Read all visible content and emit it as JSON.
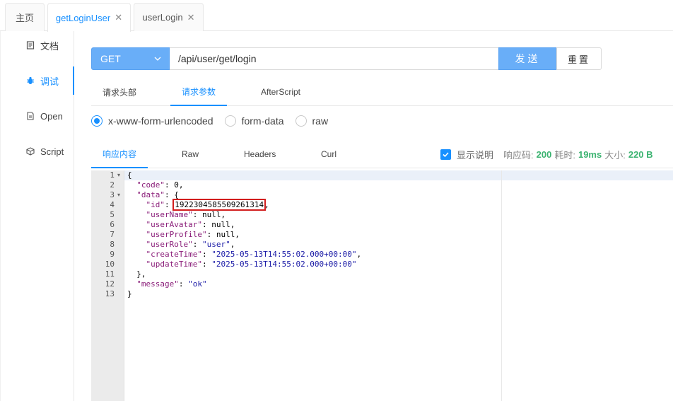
{
  "top_tabs": [
    {
      "label": "主页",
      "closable": false
    },
    {
      "label": "getLoginUser",
      "closable": true,
      "active": true
    },
    {
      "label": "userLogin",
      "closable": true
    }
  ],
  "close_glyph": "✕",
  "sidebar": [
    {
      "label": "文档",
      "icon": "document-icon"
    },
    {
      "label": "调试",
      "icon": "bug-icon",
      "active": true
    },
    {
      "label": "Open",
      "icon": "file-icon"
    },
    {
      "label": "Script",
      "icon": "cube-icon"
    }
  ],
  "request": {
    "method": "GET",
    "url": "/api/user/get/login",
    "send_label": "发送",
    "reset_label": "重置"
  },
  "req_tabs": [
    "请求头部",
    "请求参数",
    "AfterScript"
  ],
  "body_types": [
    "x-www-form-urlencoded",
    "form-data",
    "raw"
  ],
  "resp_tabs": [
    "响应内容",
    "Raw",
    "Headers",
    "Curl"
  ],
  "resp_meta": {
    "show_desc_label": "显示说明",
    "status_label": "响应码:",
    "status": "200",
    "time_label": "耗时:",
    "time": "19ms",
    "size_label": "大小:",
    "size": "220 B"
  },
  "code_lines": [
    {
      "n": "1",
      "fold": true
    },
    {
      "n": "2"
    },
    {
      "n": "3",
      "fold": true
    },
    {
      "n": "4"
    },
    {
      "n": "5"
    },
    {
      "n": "6"
    },
    {
      "n": "7"
    },
    {
      "n": "8"
    },
    {
      "n": "9"
    },
    {
      "n": "10"
    },
    {
      "n": "11"
    },
    {
      "n": "12"
    },
    {
      "n": "13"
    }
  ],
  "json": {
    "open": "{",
    "close": "}",
    "code_key": "\"code\"",
    "code_val": "0",
    "data_key": "\"data\"",
    "id_key": "\"id\"",
    "id_val": "1922304585509261314",
    "userName_key": "\"userName\"",
    "userAvatar_key": "\"userAvatar\"",
    "userProfile_key": "\"userProfile\"",
    "null_val": "null",
    "userRole_key": "\"userRole\"",
    "userRole_val": "\"user\"",
    "createTime_key": "\"createTime\"",
    "createTime_val": "\"2025-05-13T14:55:02.000+00:00\"",
    "updateTime_key": "\"updateTime\"",
    "updateTime_val": "\"2025-05-13T14:55:02.000+00:00\"",
    "message_key": "\"message\"",
    "message_val": "\"ok\""
  }
}
